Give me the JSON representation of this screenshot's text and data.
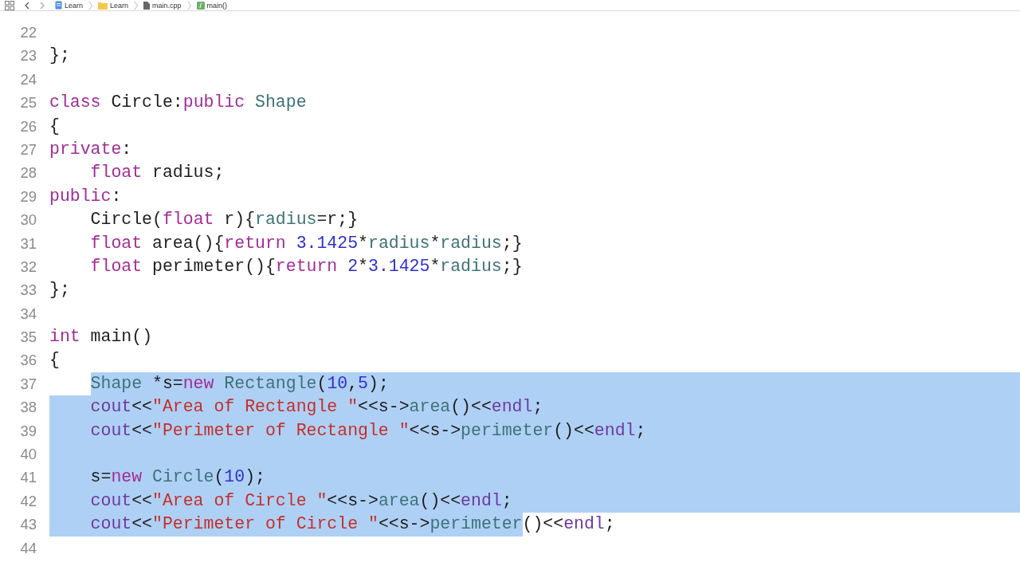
{
  "breadcrumb": [
    {
      "kind": "project",
      "label": "Learn"
    },
    {
      "kind": "folder",
      "label": "Learn"
    },
    {
      "kind": "file",
      "label": "main.cpp"
    },
    {
      "kind": "function",
      "label": "main()"
    }
  ],
  "lines": [
    {
      "number": "22",
      "selected": false
    },
    {
      "number": "23",
      "selected": false,
      "indented": false,
      "tokens": [
        {
          "text": "};",
          "kind": "plain",
          "selected": false
        }
      ]
    },
    {
      "number": "24",
      "selected": false
    },
    {
      "number": "25",
      "selected": false,
      "indented": false,
      "tokens": [
        {
          "text": "class",
          "kind": "keyword",
          "selected": false
        },
        {
          "text": " Circle:",
          "kind": "plain",
          "selected": false
        },
        {
          "text": "public",
          "kind": "keyword",
          "selected": false
        },
        {
          "text": " Shape",
          "kind": "type",
          "selected": false
        }
      ]
    },
    {
      "number": "26",
      "selected": false,
      "indented": false,
      "tokens": [
        {
          "text": "{",
          "kind": "plain",
          "selected": false
        }
      ]
    },
    {
      "number": "27",
      "selected": false,
      "indented": false,
      "tokens": [
        {
          "text": "private",
          "kind": "keyword",
          "selected": false
        },
        {
          "text": ":",
          "kind": "plain",
          "selected": false
        }
      ]
    },
    {
      "number": "28",
      "selected": false,
      "indented": true,
      "indent_selected": false,
      "tokens": [
        {
          "text": "float",
          "kind": "keyword",
          "selected": false
        },
        {
          "text": " radius;",
          "kind": "plain",
          "selected": false
        }
      ]
    },
    {
      "number": "29",
      "selected": false,
      "indented": false,
      "tokens": [
        {
          "text": "public",
          "kind": "keyword",
          "selected": false
        },
        {
          "text": ":",
          "kind": "plain",
          "selected": false
        }
      ]
    },
    {
      "number": "30",
      "selected": false,
      "indented": true,
      "indent_selected": false,
      "tokens": [
        {
          "text": "Circle(",
          "kind": "plain",
          "selected": false
        },
        {
          "text": "float",
          "kind": "keyword",
          "selected": false
        },
        {
          "text": " r){",
          "kind": "plain",
          "selected": false
        },
        {
          "text": "radius",
          "kind": "ident",
          "selected": false
        },
        {
          "text": "=r;}",
          "kind": "plain",
          "selected": false
        }
      ]
    },
    {
      "number": "31",
      "selected": false,
      "indented": true,
      "indent_selected": false,
      "tokens": [
        {
          "text": "float",
          "kind": "keyword",
          "selected": false
        },
        {
          "text": " area(){",
          "kind": "plain",
          "selected": false
        },
        {
          "text": "return",
          "kind": "keyword",
          "selected": false
        },
        {
          "text": " 3.1425",
          "kind": "number",
          "selected": false
        },
        {
          "text": "*",
          "kind": "plain",
          "selected": false
        },
        {
          "text": "radius",
          "kind": "ident",
          "selected": false
        },
        {
          "text": "*",
          "kind": "plain",
          "selected": false
        },
        {
          "text": "radius",
          "kind": "ident",
          "selected": false
        },
        {
          "text": ";}",
          "kind": "plain",
          "selected": false
        }
      ]
    },
    {
      "number": "32",
      "selected": false,
      "indented": true,
      "indent_selected": false,
      "tokens": [
        {
          "text": "float",
          "kind": "keyword",
          "selected": false
        },
        {
          "text": " perimeter(){",
          "kind": "plain",
          "selected": false
        },
        {
          "text": "return",
          "kind": "keyword",
          "selected": false
        },
        {
          "text": " 2",
          "kind": "number",
          "selected": false
        },
        {
          "text": "*",
          "kind": "plain",
          "selected": false
        },
        {
          "text": "3.1425",
          "kind": "number",
          "selected": false
        },
        {
          "text": "*",
          "kind": "plain",
          "selected": false
        },
        {
          "text": "radius",
          "kind": "ident",
          "selected": false
        },
        {
          "text": ";}",
          "kind": "plain",
          "selected": false
        }
      ]
    },
    {
      "number": "33",
      "selected": false,
      "indented": false,
      "tokens": [
        {
          "text": "};",
          "kind": "plain",
          "selected": false
        }
      ]
    },
    {
      "number": "34",
      "selected": false
    },
    {
      "number": "35",
      "selected": false,
      "indented": false,
      "tokens": [
        {
          "text": "int",
          "kind": "keyword",
          "selected": false
        },
        {
          "text": " main()",
          "kind": "plain",
          "selected": false
        }
      ]
    },
    {
      "number": "36",
      "selected": false,
      "indented": false,
      "tokens": [
        {
          "text": "{",
          "kind": "plain",
          "selected": false
        }
      ]
    },
    {
      "number": "37",
      "selected": true,
      "indented": true,
      "indent_selected": false,
      "tokens": [
        {
          "text": "Shape",
          "kind": "type",
          "selected": true
        },
        {
          "text": " *s=",
          "kind": "plain",
          "selected": true
        },
        {
          "text": "new",
          "kind": "keyword",
          "selected": true
        },
        {
          "text": " Rectangle",
          "kind": "type",
          "selected": true
        },
        {
          "text": "(",
          "kind": "plain",
          "selected": true
        },
        {
          "text": "10",
          "kind": "number",
          "selected": true
        },
        {
          "text": ",",
          "kind": "plain",
          "selected": true
        },
        {
          "text": "5",
          "kind": "number",
          "selected": true
        },
        {
          "text": ");",
          "kind": "plain",
          "selected": true
        }
      ]
    },
    {
      "number": "38",
      "selected": true,
      "indented": true,
      "indent_selected": true,
      "tokens": [
        {
          "text": "cout",
          "kind": "library",
          "selected": true
        },
        {
          "text": "<<",
          "kind": "plain",
          "selected": true
        },
        {
          "text": "\"Area of Rectangle \"",
          "kind": "string",
          "selected": true
        },
        {
          "text": "<<s->",
          "kind": "plain",
          "selected": true
        },
        {
          "text": "area",
          "kind": "ident",
          "selected": true
        },
        {
          "text": "()<<",
          "kind": "plain",
          "selected": true
        },
        {
          "text": "endl",
          "kind": "library",
          "selected": true
        },
        {
          "text": ";",
          "kind": "plain",
          "selected": true
        }
      ]
    },
    {
      "number": "39",
      "selected": true,
      "indented": true,
      "indent_selected": true,
      "tokens": [
        {
          "text": "cout",
          "kind": "library",
          "selected": true
        },
        {
          "text": "<<",
          "kind": "plain",
          "selected": true
        },
        {
          "text": "\"Perimeter of Rectangle \"",
          "kind": "string",
          "selected": true
        },
        {
          "text": "<<s->",
          "kind": "plain",
          "selected": true
        },
        {
          "text": "perimeter",
          "kind": "ident",
          "selected": true
        },
        {
          "text": "()<<",
          "kind": "plain",
          "selected": true
        },
        {
          "text": "endl",
          "kind": "library",
          "selected": true
        },
        {
          "text": ";",
          "kind": "plain",
          "selected": true
        }
      ]
    },
    {
      "number": "40",
      "selected": true
    },
    {
      "number": "41",
      "selected": true,
      "indented": true,
      "indent_selected": true,
      "tokens": [
        {
          "text": "s=",
          "kind": "plain",
          "selected": true
        },
        {
          "text": "new",
          "kind": "keyword",
          "selected": true
        },
        {
          "text": " Circle",
          "kind": "type",
          "selected": true
        },
        {
          "text": "(",
          "kind": "plain",
          "selected": true
        },
        {
          "text": "10",
          "kind": "number",
          "selected": true
        },
        {
          "text": ");",
          "kind": "plain",
          "selected": true
        }
      ]
    },
    {
      "number": "42",
      "selected": true,
      "indented": true,
      "indent_selected": true,
      "tokens": [
        {
          "text": "cout",
          "kind": "library",
          "selected": true
        },
        {
          "text": "<<",
          "kind": "plain",
          "selected": true
        },
        {
          "text": "\"Area of Circle \"",
          "kind": "string",
          "selected": true
        },
        {
          "text": "<<s->",
          "kind": "plain",
          "selected": true
        },
        {
          "text": "area",
          "kind": "ident",
          "selected": true
        },
        {
          "text": "()<<",
          "kind": "plain",
          "selected": true
        },
        {
          "text": "endl",
          "kind": "library",
          "selected": true
        },
        {
          "text": ";",
          "kind": "plain",
          "selected": true
        }
      ]
    },
    {
      "number": "43",
      "selected": false,
      "indented": true,
      "indent_selected": true,
      "tokens": [
        {
          "text": "cout",
          "kind": "library",
          "selected": true
        },
        {
          "text": "<<",
          "kind": "plain",
          "selected": true
        },
        {
          "text": "\"Perimeter of Circle \"",
          "kind": "string",
          "selected": true
        },
        {
          "text": "<<s->",
          "kind": "plain",
          "selected": true
        },
        {
          "text": "perimeter",
          "kind": "ident",
          "selected": true
        },
        {
          "text": "()<<",
          "kind": "plain",
          "selected": false
        },
        {
          "text": "endl",
          "kind": "library",
          "selected": false
        },
        {
          "text": ";",
          "kind": "plain",
          "selected": false
        }
      ]
    },
    {
      "number": "44",
      "selected": false
    }
  ]
}
